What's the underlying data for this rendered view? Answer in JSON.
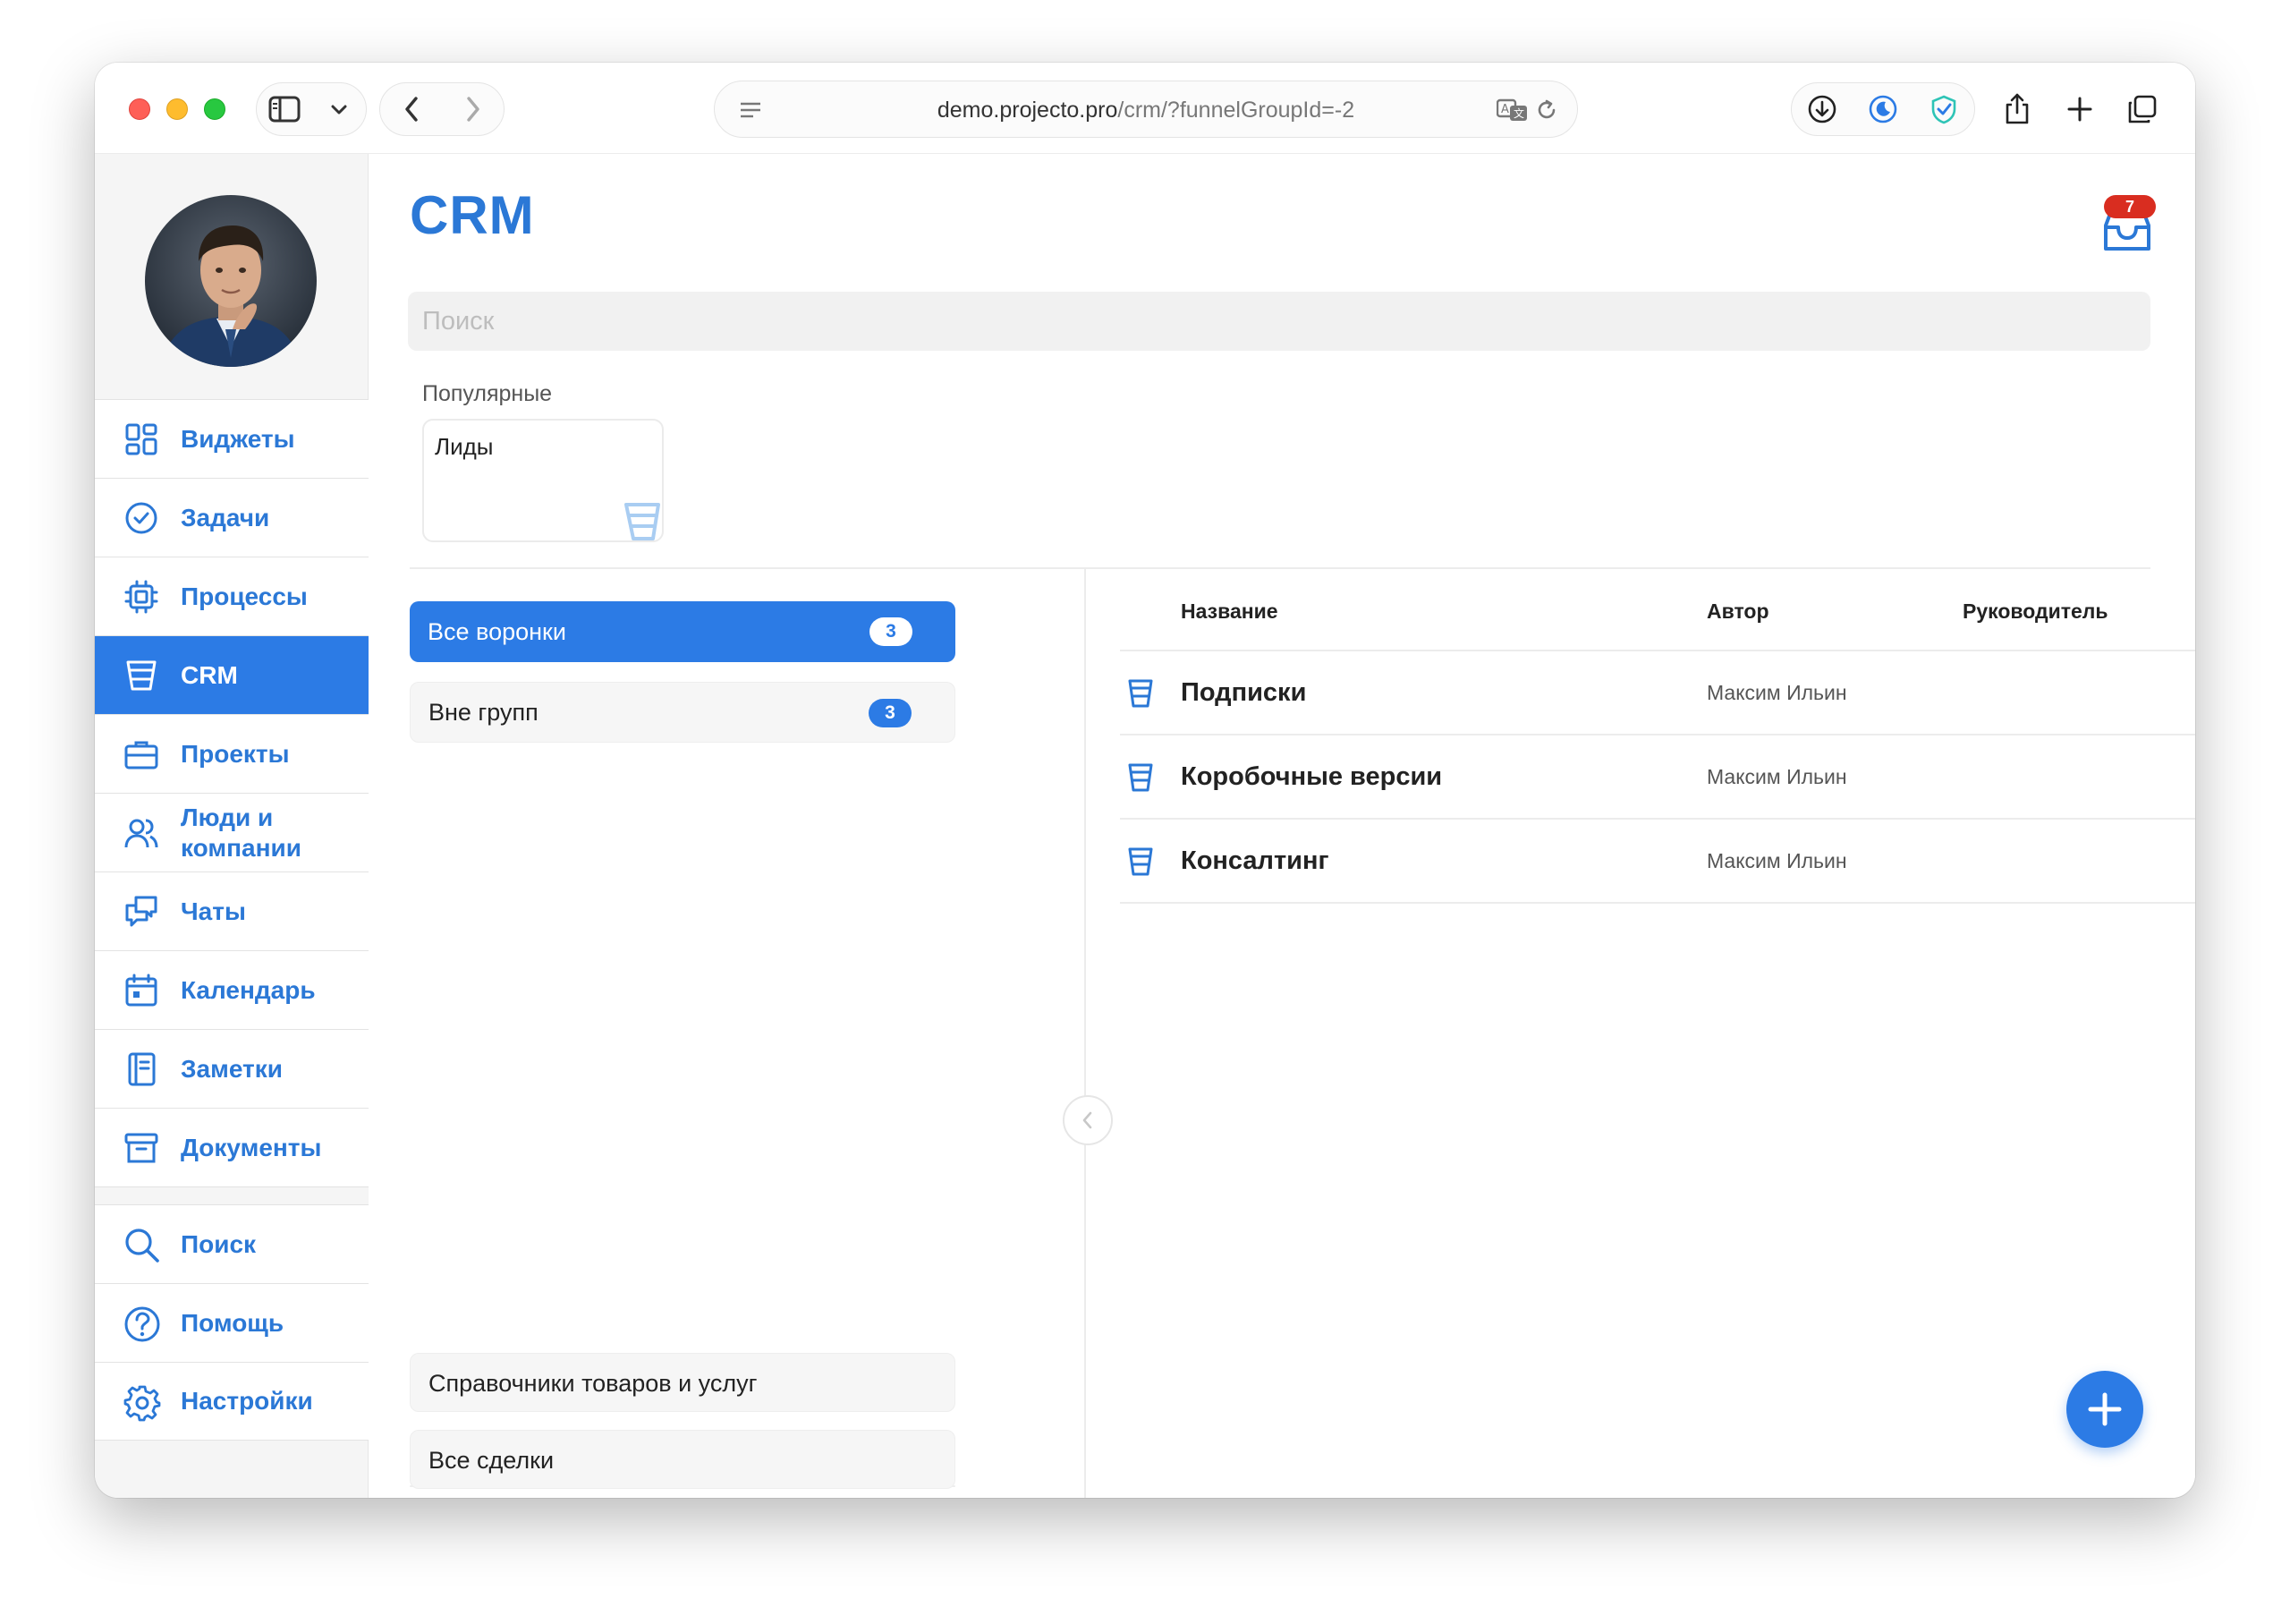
{
  "browser": {
    "url_domain": "demo.projecto.pro",
    "url_path": "/crm/?funnelGroupId=-2"
  },
  "sidebar": {
    "items": [
      {
        "label": "Виджеты",
        "icon": "widgets-icon"
      },
      {
        "label": "Задачи",
        "icon": "check-circle-icon"
      },
      {
        "label": "Процессы",
        "icon": "chip-icon"
      },
      {
        "label": "CRM",
        "icon": "funnel-icon",
        "active": true
      },
      {
        "label": "Проекты",
        "icon": "briefcase-icon"
      },
      {
        "label": "Люди и\nкомпании",
        "icon": "people-icon"
      },
      {
        "label": "Чаты",
        "icon": "chat-icon"
      },
      {
        "label": "Календарь",
        "icon": "calendar-icon"
      },
      {
        "label": "Заметки",
        "icon": "notebook-icon"
      },
      {
        "label": "Документы",
        "icon": "archive-icon"
      }
    ],
    "bottom_items": [
      {
        "label": "Поиск",
        "icon": "search-icon"
      },
      {
        "label": "Помощь",
        "icon": "help-icon"
      },
      {
        "label": "Настройки",
        "icon": "gear-icon"
      }
    ]
  },
  "main": {
    "title": "CRM",
    "inbox_badge": "7",
    "search_placeholder": "Поиск",
    "popular_label": "Популярные",
    "popular_cards": [
      {
        "label": "Лиды"
      }
    ]
  },
  "groups": {
    "items": [
      {
        "label": "Все воронки",
        "count": "3",
        "active": true
      },
      {
        "label": "Вне групп",
        "count": "3",
        "active": false
      }
    ],
    "bottom_links": [
      "Справочники товаров и услуг",
      "Все сделки"
    ]
  },
  "table": {
    "columns": [
      "Название",
      "Автор",
      "Руководитель"
    ],
    "rows": [
      {
        "name": "Подписки",
        "author": "Максим Ильин",
        "manager": ""
      },
      {
        "name": "Коробочные версии",
        "author": "Максим Ильин",
        "manager": ""
      },
      {
        "name": "Консалтинг",
        "author": "Максим Ильин",
        "manager": ""
      }
    ]
  },
  "colors": {
    "accent": "#2c7be5",
    "badge": "#d92d20"
  }
}
